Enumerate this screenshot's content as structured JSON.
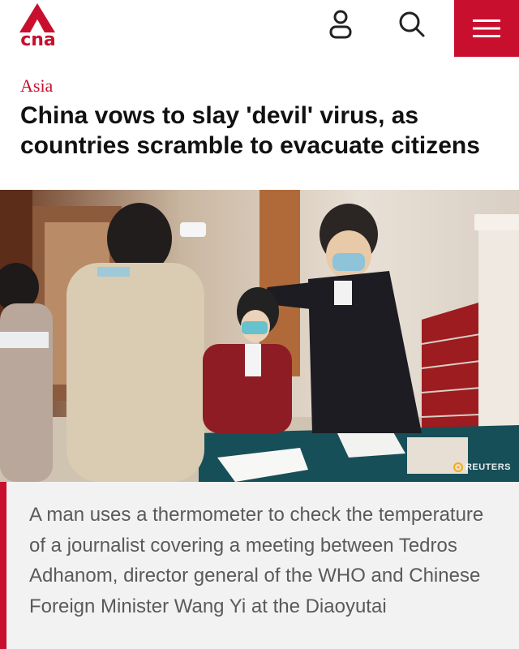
{
  "brand": {
    "name": "cna",
    "color": "#c8102e"
  },
  "header": {
    "icons": [
      "user-icon",
      "search-icon",
      "hamburger-menu-icon"
    ]
  },
  "article": {
    "category": "Asia",
    "headline": "China vows to slay 'devil' virus, as countries scramble to evacuate citizens",
    "photo": {
      "credit": "REUTERS"
    },
    "caption": "A man uses a thermometer to check the temperature of a journalist covering a meeting between Tedros Adhanom, director general of the WHO and Chinese Foreign Minister Wang Yi at the Diaoyutai"
  }
}
